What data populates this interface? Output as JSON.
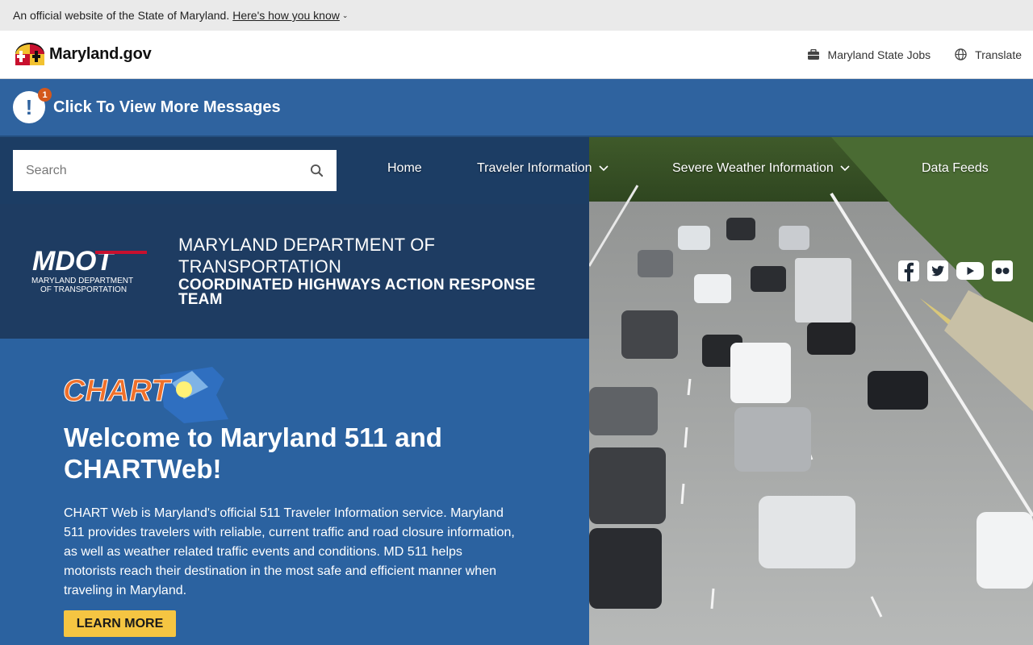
{
  "gov_banner": {
    "text": "An official website of the State of Maryland.",
    "link": "Here's how you know"
  },
  "header": {
    "brand": "Maryland.gov",
    "jobs": "Maryland State Jobs",
    "translate": "Translate"
  },
  "messages": {
    "badge": "1",
    "text": "Click To View More Messages"
  },
  "search": {
    "placeholder": "Search"
  },
  "nav": {
    "home": "Home",
    "traveler": "Traveler Information",
    "weather": "Severe Weather Information",
    "feeds": "Data Feeds"
  },
  "dept": {
    "title": "MARYLAND DEPARTMENT OF TRANSPORTATION",
    "subtitle": "COORDINATED HIGHWAYS ACTION RESPONSE TEAM",
    "logo_sub1": "MARYLAND DEPARTMENT",
    "logo_sub2": "OF TRANSPORTATION",
    "logo_text": "MDOT"
  },
  "welcome": {
    "logo_text": "CHART",
    "title": "Welcome to Maryland 511 and CHARTWeb!",
    "body": "CHART Web is Maryland's official 511 Traveler Information service. Maryland 511 provides travelers with reliable, current traffic and road closure information, as well as weather related traffic events and conditions. MD 511 helps motorists reach their destination in the most safe and efficient manner when traveling in Maryland.",
    "button": "LEARN MORE"
  },
  "social": [
    "facebook-icon",
    "twitter-icon",
    "youtube-icon",
    "flickr-icon"
  ],
  "colors": {
    "banner_blue": "#2f639f",
    "dept_navy": "#1e3c62",
    "welcome_blue": "#2b62a0",
    "button_yellow": "#f5c542",
    "badge_orange": "#d4581c"
  }
}
